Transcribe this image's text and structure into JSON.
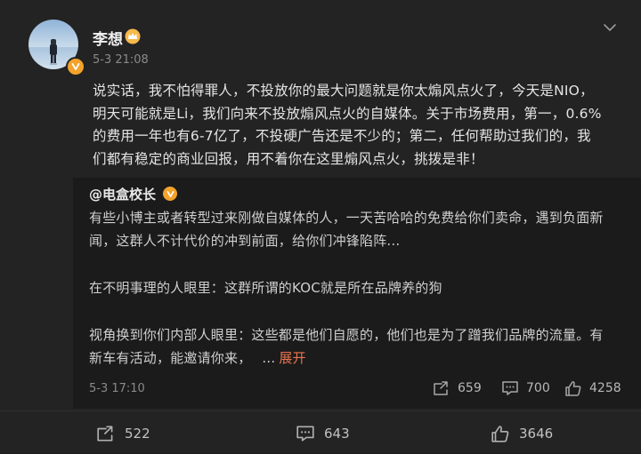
{
  "post": {
    "author": "李想",
    "time": "5-3 21:08",
    "text_lines": [
      "说实话，我不怕得罪人，不投放你的最大问题就是你太煽风点火了，今天是NIO，",
      "明天可能就是Li，我们向来不投放煽风点火的自媒体。关于市场费用，第一，0.6%",
      "的费用一年也有6-7亿了，不投硬广告还是不少的；第二，任何帮助过我们的，我",
      "们都有稳定的商业回报，用不着你在这里煽风点火，挑拨是非！"
    ]
  },
  "repost": {
    "author": "@电盒校长",
    "p1_lines": [
      "有些小博主或者转型过来刚做自媒体的人，一天苦哈哈的免费给你们卖命，遇到负面新",
      "闻，这群人不计代价的冲到前面，给你们冲锋陷阵..."
    ],
    "p2": "在不明事理的人眼里：这群所谓的KOC就是所在品牌养的狗",
    "p3_lines": [
      "视角换到你们内部人眼里：这些都是他们自愿的，他们也是为了蹭我们品牌的流量。有",
      "新车有活动，能邀请你来，"
    ],
    "ellipsis": "...",
    "expand_label": "展开",
    "time": "5-3 17:10",
    "reposts": "659",
    "comments": "700",
    "likes": "4258"
  },
  "actions": {
    "reposts": "522",
    "comments": "643",
    "likes": "3646"
  },
  "colors": {
    "accent": "#eb7350",
    "verified": "#f3a32b",
    "background": "#232324"
  },
  "icons": [
    "avatar",
    "crown-icon",
    "verified-icon",
    "chevron-down-icon",
    "repost-icon",
    "comment-icon",
    "like-icon"
  ]
}
